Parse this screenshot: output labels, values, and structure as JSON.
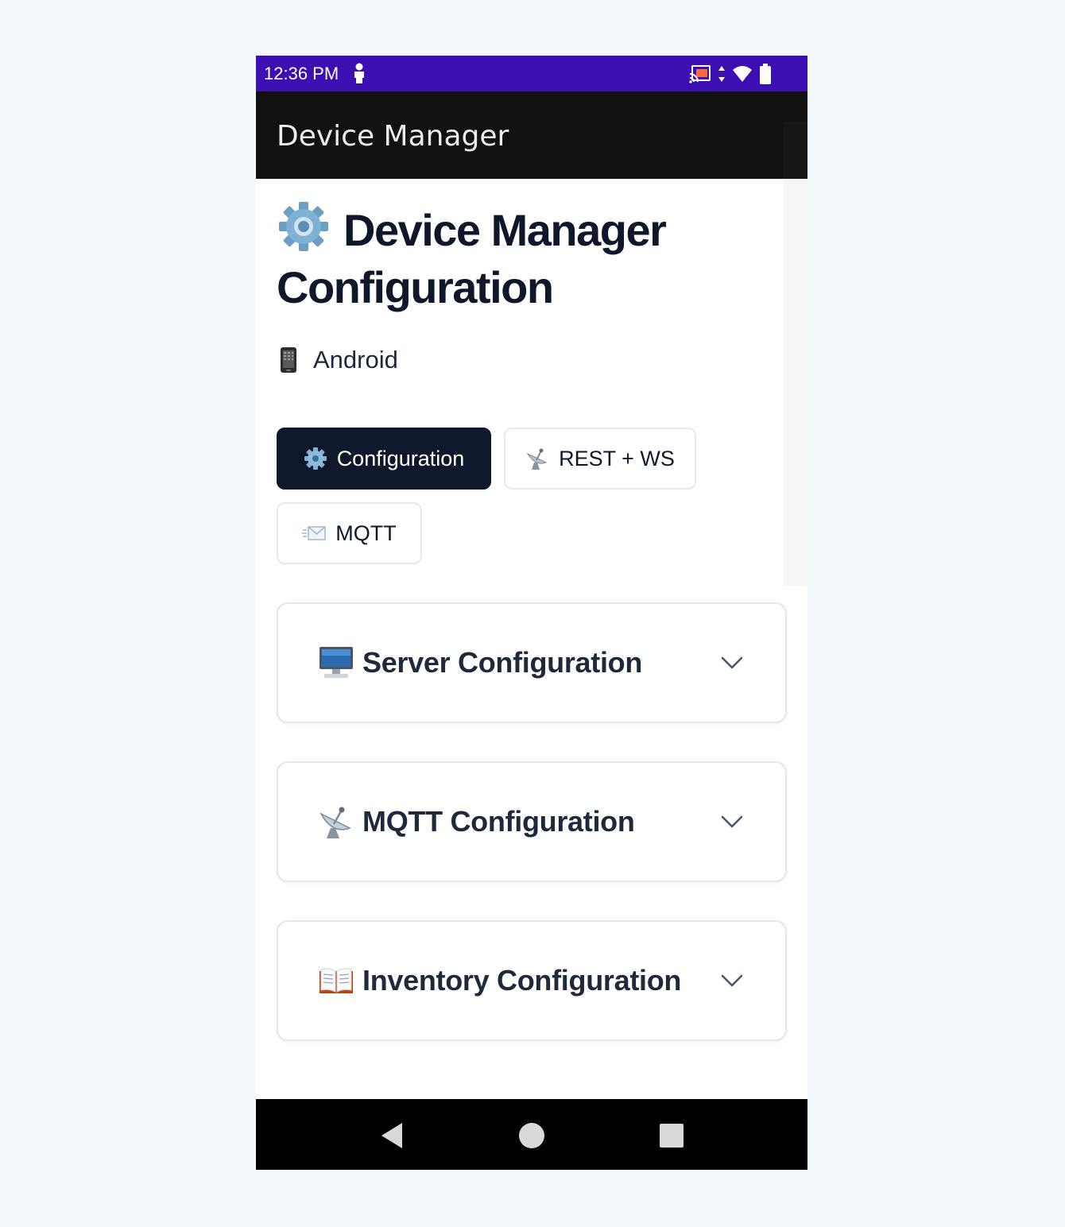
{
  "status_bar": {
    "time": "12:36 PM",
    "icons": [
      "person-icon",
      "cast-icon",
      "data-arrows-icon",
      "wifi-icon",
      "battery-icon"
    ]
  },
  "app_bar": {
    "title": "Device Manager"
  },
  "header": {
    "title": "Device Manager Configuration",
    "title_icon": "gear-icon",
    "platform_icon": "mobile-phone-icon",
    "platform": "Android"
  },
  "tabs": [
    {
      "label": "Configuration",
      "icon": "gear-icon",
      "active": true
    },
    {
      "label": "REST + WS",
      "icon": "satellite-antenna-icon",
      "active": false
    },
    {
      "label": "MQTT",
      "icon": "envelope-icon",
      "active": false
    }
  ],
  "sections": [
    {
      "title": "Server Configuration",
      "icon": "desktop-computer-icon",
      "expanded": false
    },
    {
      "title": "MQTT Configuration",
      "icon": "satellite-antenna-icon",
      "expanded": false
    },
    {
      "title": "Inventory Configuration",
      "icon": "open-book-icon",
      "expanded": false
    }
  ],
  "nav_bar": {
    "buttons": [
      "back-icon",
      "home-icon",
      "recents-icon"
    ]
  },
  "colors": {
    "status_bar": "#3d0fb3",
    "app_bar": "#111111",
    "active_tab": "#0f172a",
    "text_primary": "#0f172a"
  }
}
